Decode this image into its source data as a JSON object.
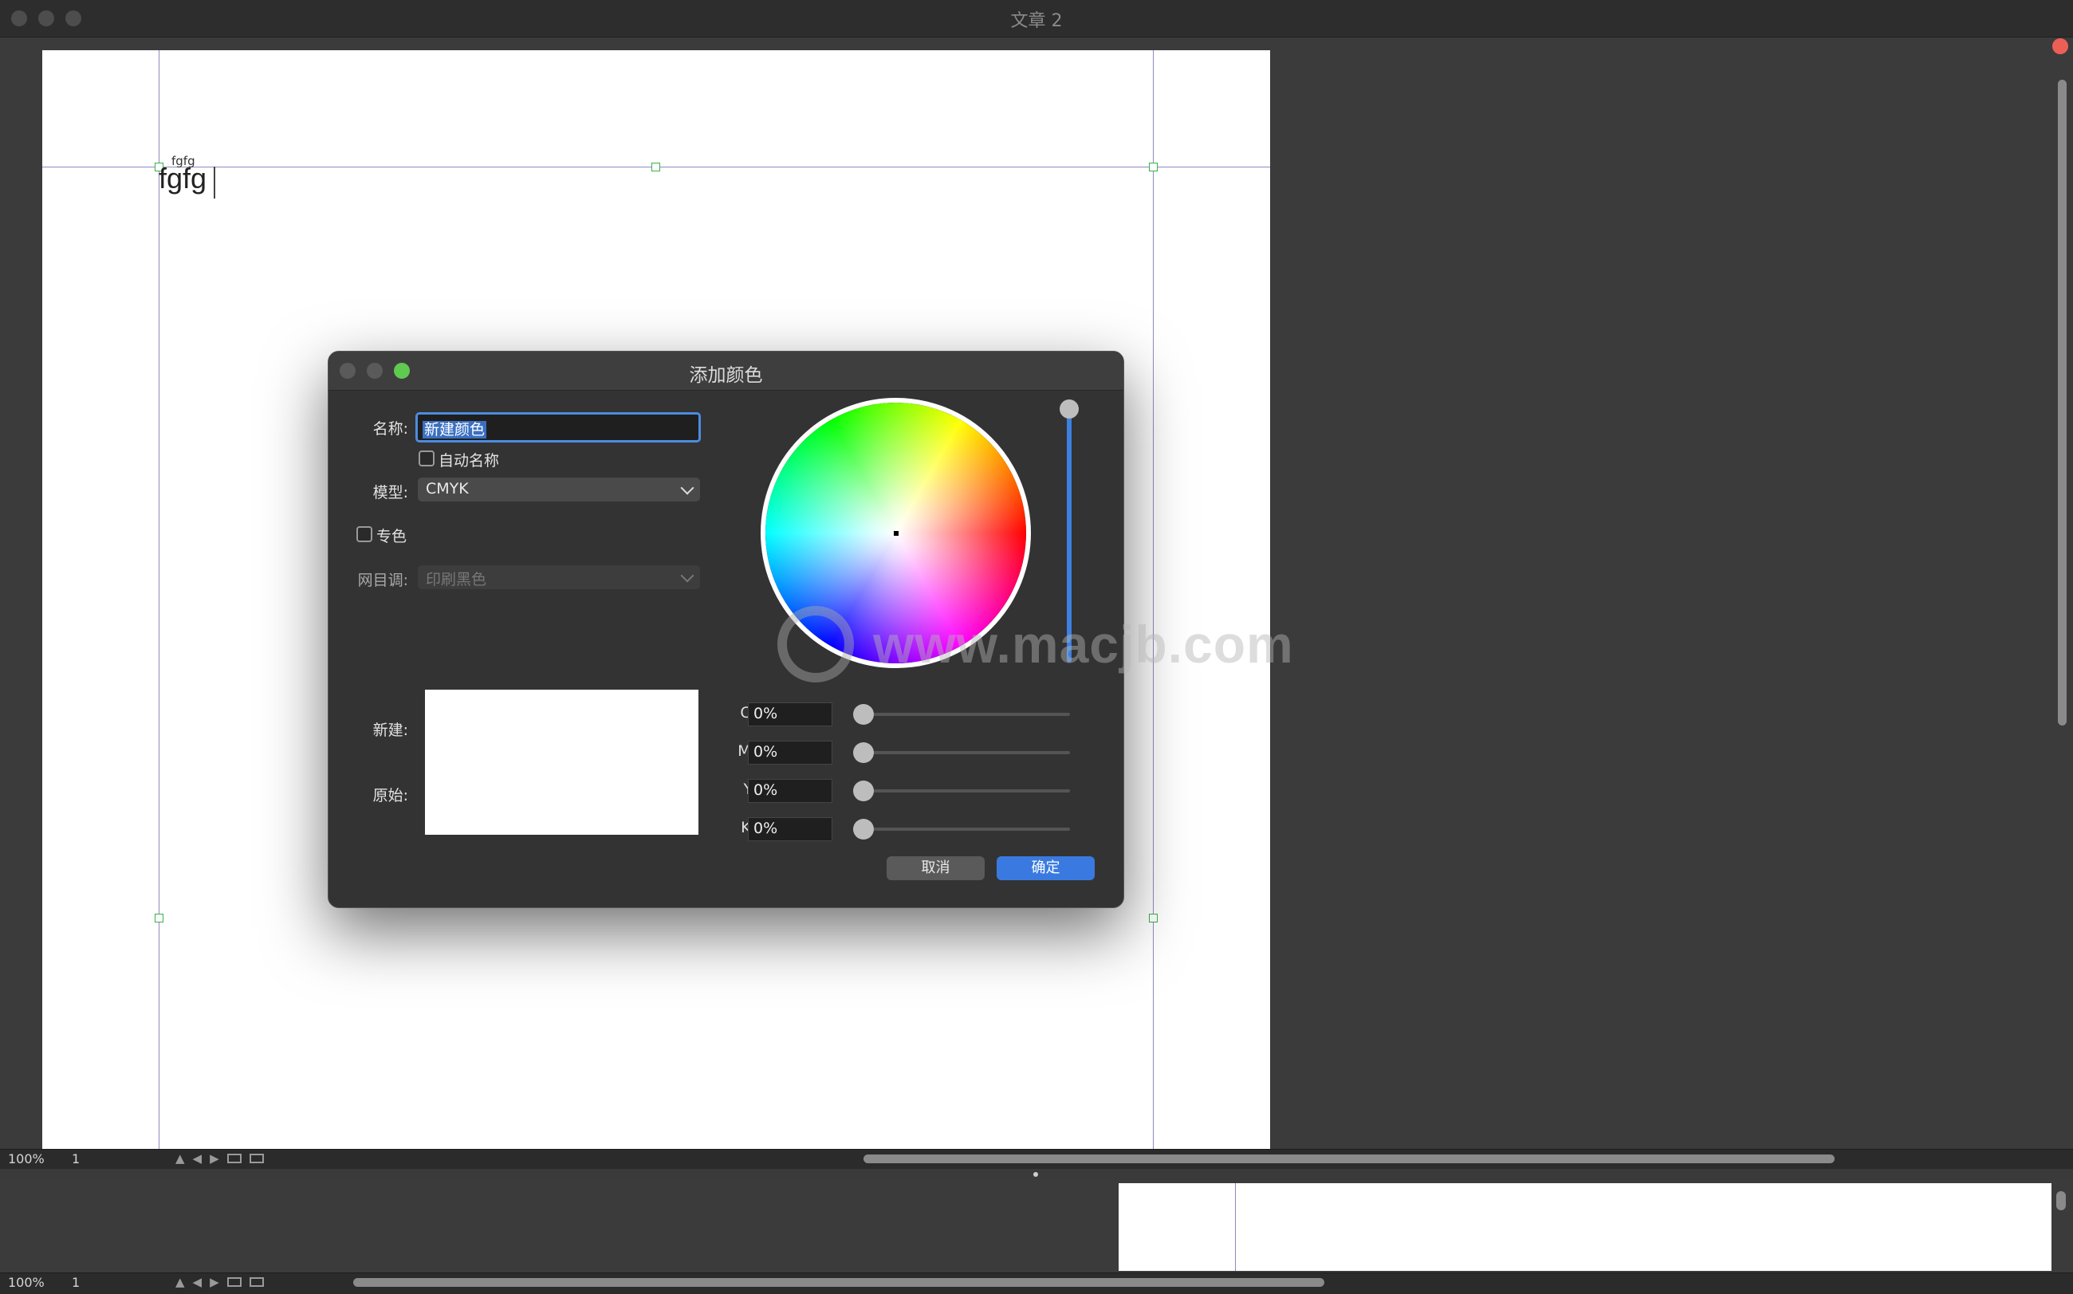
{
  "window": {
    "title": "文章 2"
  },
  "document": {
    "text_small": "fgfg",
    "text_big": "fgfg"
  },
  "status_top": {
    "zoom": "100%",
    "page": "1"
  },
  "status_bottom": {
    "zoom": "100%",
    "page": "1"
  },
  "icons": {
    "up": "▲",
    "left": "◀",
    "right": "▶"
  },
  "dialog": {
    "title": "添加颜色",
    "name_label": "名称:",
    "name_value": "新建颜色",
    "auto_name_label": "自动名称",
    "model_label": "模型:",
    "model_value": "CMYK",
    "spot_label": "专色",
    "halftone_label": "网目调:",
    "halftone_value": "印刷黑色",
    "new_label": "新建:",
    "original_label": "原始:",
    "channels": [
      {
        "label": "C:",
        "value": "0%",
        "level": 0
      },
      {
        "label": "M:",
        "value": "0%",
        "level": 0
      },
      {
        "label": "Y:",
        "value": "0%",
        "level": 0
      },
      {
        "label": "K:",
        "value": "0%",
        "level": 0
      }
    ],
    "cancel_label": "取消",
    "ok_label": "确定",
    "colors": {
      "accent": "#3a7ae0",
      "close": "#ec5f57",
      "zoom": "#5fc950"
    }
  },
  "watermark": {
    "text": "www.macjb.com"
  }
}
